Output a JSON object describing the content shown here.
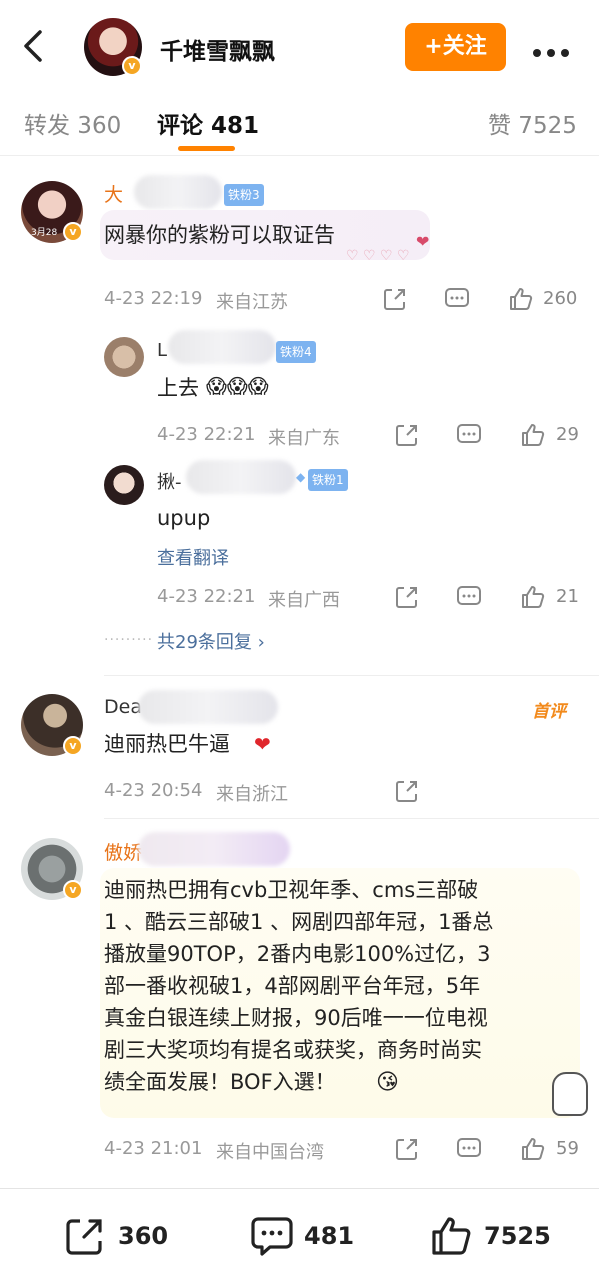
{
  "header": {
    "title": "千堆雪飘飘",
    "follow_label": "+关注"
  },
  "tabs": [
    {
      "label": "转发 360"
    },
    {
      "label": "评论 481"
    },
    {
      "label": "赞 7525"
    }
  ],
  "comments": [
    {
      "name": "大",
      "fan_badge": "铁粉3",
      "text": "网暴你的紫粉可以取证告",
      "time": "4-23 22:19",
      "location": "来自江苏",
      "likes": "260",
      "avatar_text": "3月28",
      "replies": [
        {
          "name": "L",
          "fan_badge": "铁粉4",
          "text": "上去",
          "time": "4-23 22:21",
          "location": "来自广东",
          "likes": "29"
        },
        {
          "name": "揪-",
          "fan_badge": "铁粉1",
          "text": "upup",
          "translate": "查看翻译",
          "time": "4-23 22:21",
          "location": "来自广西",
          "likes": "21"
        }
      ],
      "more_replies": "共29条回复 ›"
    },
    {
      "name": "Dea",
      "first_badge": "首评",
      "text": "迪丽热巴牛逼",
      "time": "4-23 20:54",
      "location": "来自浙江"
    },
    {
      "name": "傲娇",
      "text_lines": [
        "迪丽热巴拥有cvb卫视年季、cms三部破",
        "1 、酷云三部破1 、网剧四部年冠，1番总",
        "播放量90TOP，2番内电影100%过亿，3",
        "部一番收视破1，4部网剧平台年冠，5年",
        "真金白银连续上财报，90后唯一一位电视",
        "剧三大奖项均有提名或获奖，商务时尚实",
        "绩全面发展！BOF入選！"
      ],
      "time": "4-23 21:01",
      "location": "来自中国台湾",
      "likes": "59"
    }
  ],
  "footer": {
    "repost_count": "360",
    "comment_count": "481",
    "like_count": "7525"
  },
  "colors": {
    "accent": "#ff8200",
    "link": "#4b6f9c",
    "username_orange": "#e8741a",
    "fan_badge": "#7db3f0"
  }
}
